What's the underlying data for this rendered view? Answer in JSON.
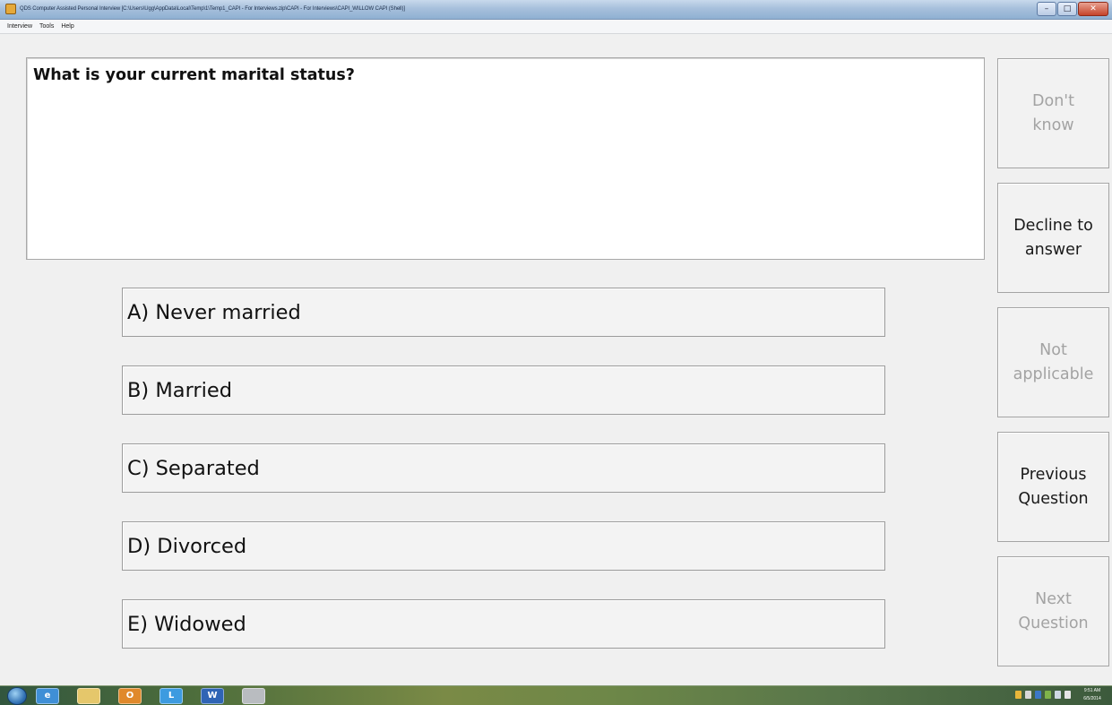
{
  "window": {
    "title": "QDS Computer Assisted Personal Interview [C:\\Users\\Ugg\\AppData\\Local\\Temp\\1\\Temp1_CAPI - For Interviews.zip\\CAPI - For Interviews\\CAPI_WILLOW CAPI (Shell)]",
    "minimize_label": "–",
    "maximize_label": "□",
    "close_label": "✕"
  },
  "menu": {
    "items": [
      "Interview",
      "Tools",
      "Help"
    ]
  },
  "question": {
    "text": "What is your current marital status?"
  },
  "options": [
    {
      "label": "A) Never married"
    },
    {
      "label": "B) Married"
    },
    {
      "label": "C) Separated"
    },
    {
      "label": "D) Divorced"
    },
    {
      "label": "E) Widowed"
    }
  ],
  "side_buttons": [
    {
      "label": "Don't\nknow",
      "state": "disabled"
    },
    {
      "label": "Decline to\nanswer",
      "state": "enabled"
    },
    {
      "label": "Not\napplicable",
      "state": "disabled"
    },
    {
      "label": "Previous\nQuestion",
      "state": "enabled"
    },
    {
      "label": "Next\nQuestion",
      "state": "disabled"
    }
  ],
  "taskbar": {
    "apps": [
      {
        "icon": "internet-explorer-icon",
        "glyph": "e",
        "color": "#3f8fd6"
      },
      {
        "icon": "file-explorer-icon",
        "glyph": "",
        "color": "#e5c76b"
      },
      {
        "icon": "outlook-icon",
        "glyph": "O",
        "color": "#e0892b"
      },
      {
        "icon": "lync-icon",
        "glyph": "L",
        "color": "#3d9be0"
      },
      {
        "icon": "word-icon",
        "glyph": "W",
        "color": "#2f64b5"
      },
      {
        "icon": "qds-app-icon",
        "glyph": "",
        "color": "#b9bcc0"
      }
    ],
    "clock_time": "9:51 AM",
    "clock_date": "6/5/2014"
  }
}
